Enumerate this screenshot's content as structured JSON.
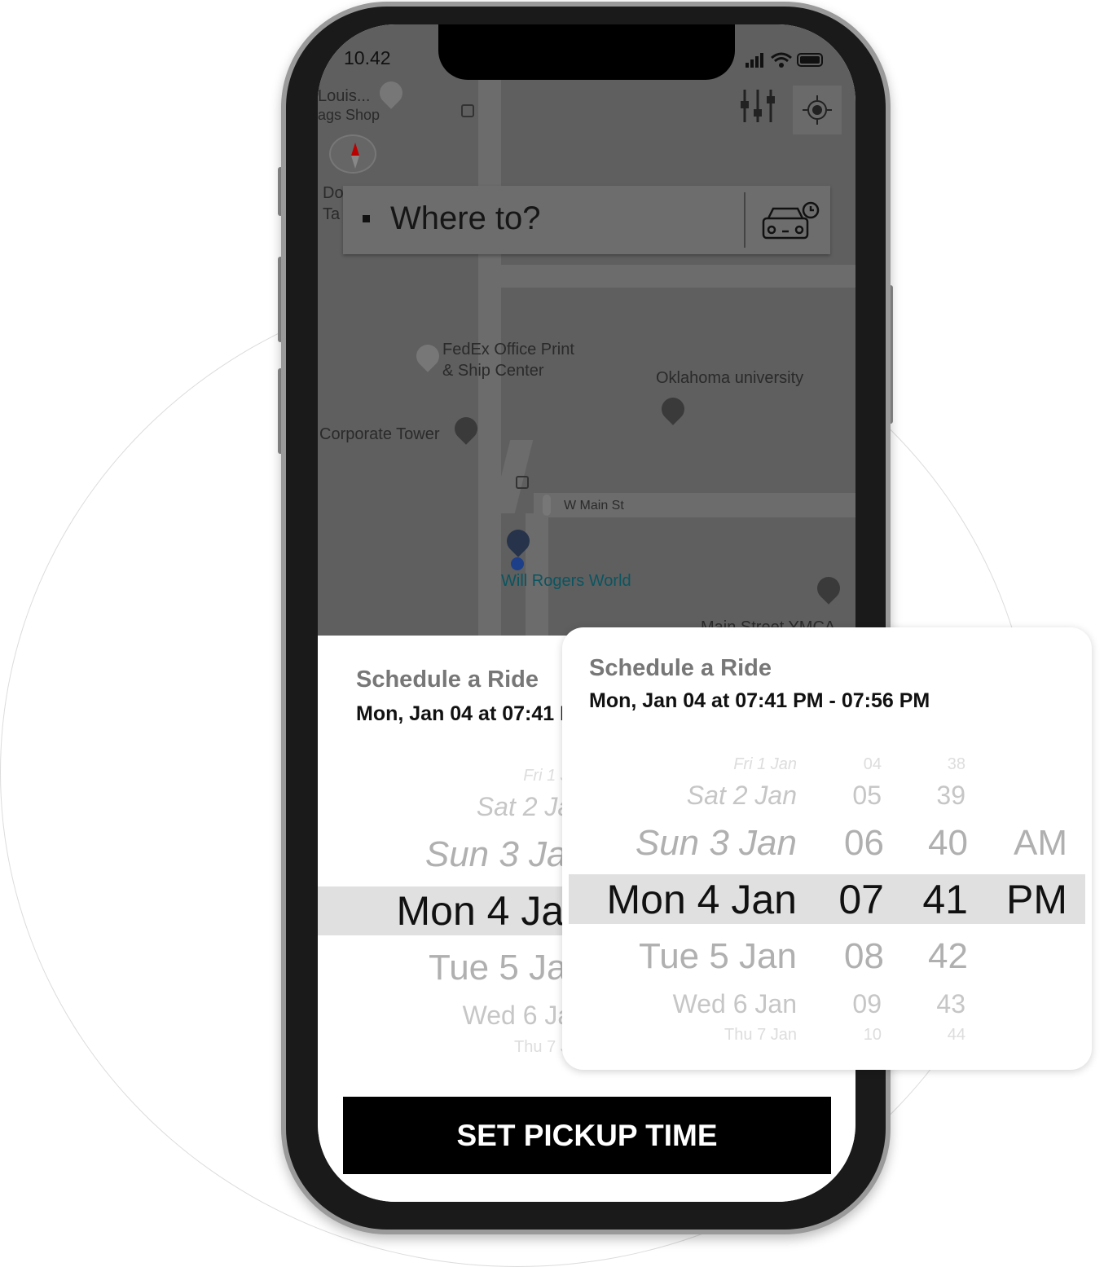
{
  "status_bar": {
    "time": "10.42"
  },
  "map": {
    "labels": [
      "Louis...",
      "ags Shop",
      "Do",
      "Ta",
      "FedEx Office Print",
      "& Ship Center",
      "Oklahoma university",
      "Corporate Tower",
      "W Main St",
      "Will Rogers World",
      "Main Street YMCA"
    ],
    "search_placeholder": "Where to?",
    "icons": [
      "filter-sliders-icon",
      "my-location-icon",
      "compass-icon",
      "scheduled-car-icon"
    ]
  },
  "sheet": {
    "title": "Schedule a Ride",
    "subtitle": "Mon, Jan 04 at 07:41 PM - 07:56 PM",
    "dates": [
      "Fri 1 Jan",
      "Sat 2 Jan",
      "Sun 3 Jan",
      "Mon 4 Jan",
      "Tue 5 Jan",
      "Wed 6 Jan",
      "Thu 7 Jan"
    ],
    "button": "SET PICKUP TIME"
  },
  "card": {
    "title": "Schedule a Ride",
    "subtitle": "Mon, Jan 04 at 07:41 PM - 07:56 PM",
    "dates": [
      "Fri 1 Jan",
      "Sat 2 Jan",
      "Sun 3 Jan",
      "Mon 4 Jan",
      "Tue 5 Jan",
      "Wed 6 Jan",
      "Thu 7 Jan"
    ],
    "hours": [
      "04",
      "05",
      "06",
      "07",
      "08",
      "09",
      "10"
    ],
    "minutes": [
      "38",
      "39",
      "40",
      "41",
      "42",
      "43",
      "44"
    ],
    "ampm": [
      "AM",
      "PM"
    ],
    "selected": {
      "date": "Mon 4 Jan",
      "hour": "07",
      "minute": "41",
      "ampm": "PM"
    }
  },
  "colors": {
    "button_bg": "#000000",
    "highlight": "#e0e0e0",
    "map_overlay": "#5f5f5f",
    "link_teal": "#0b5560"
  }
}
